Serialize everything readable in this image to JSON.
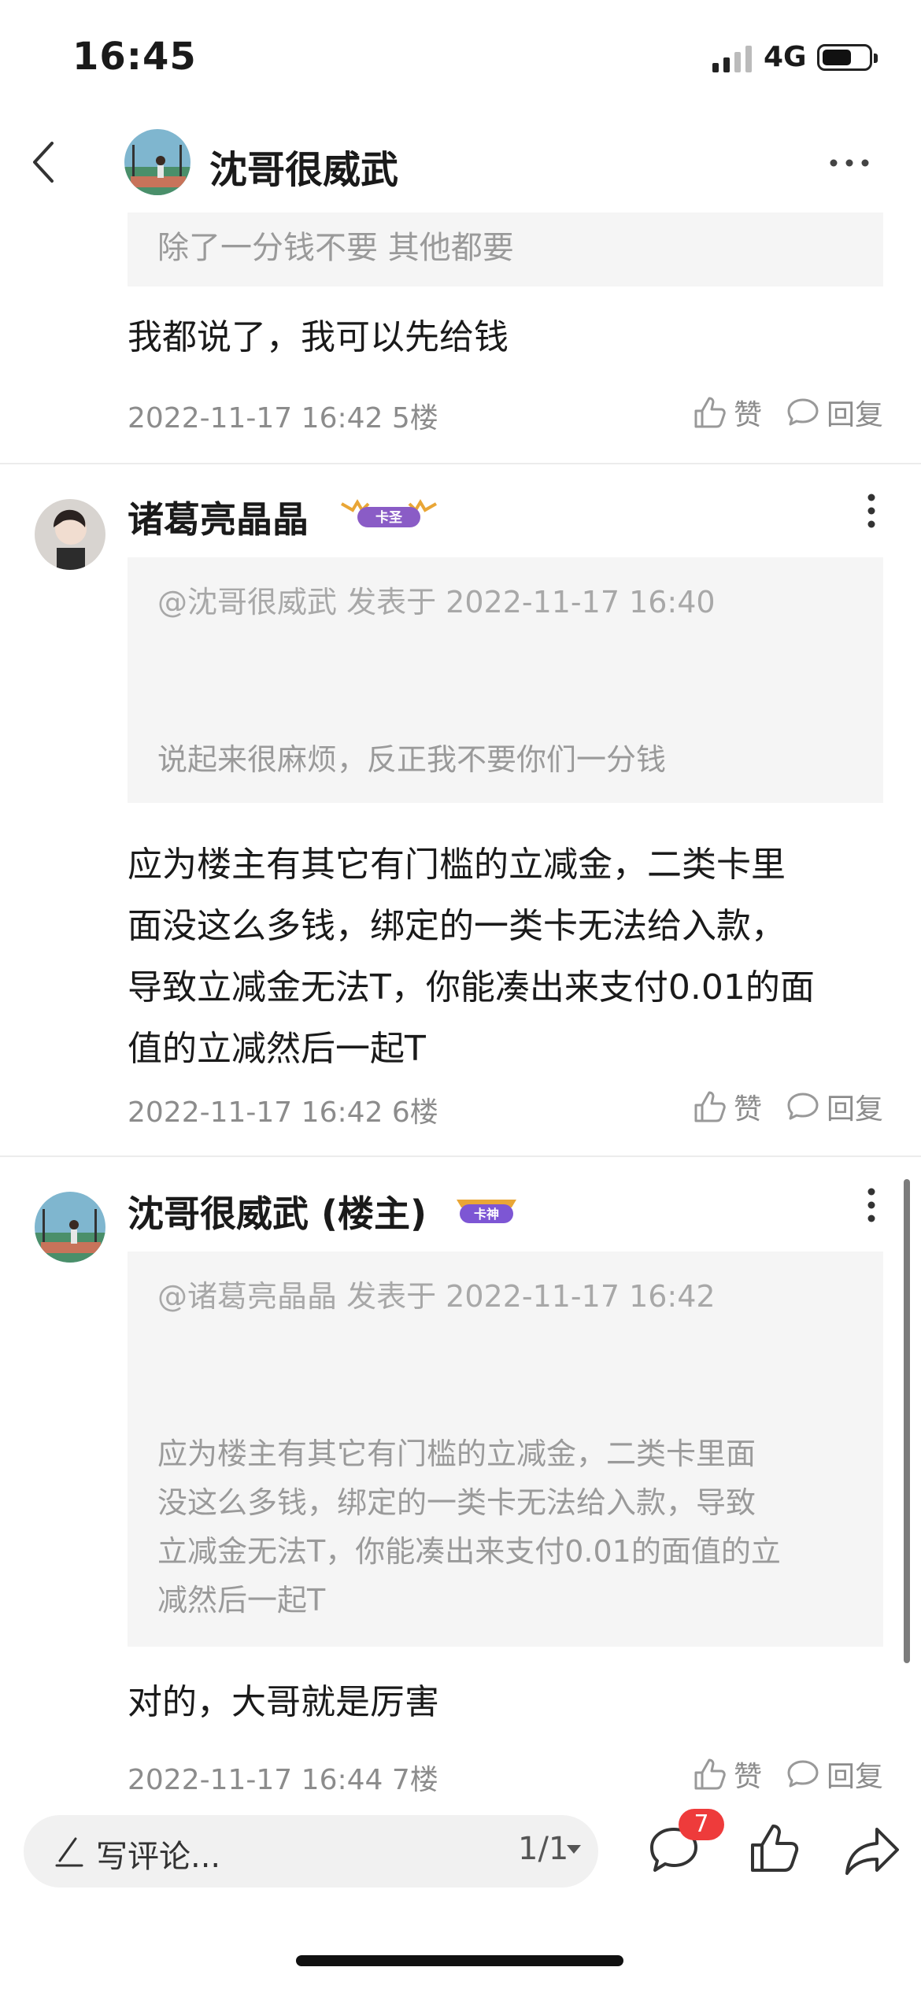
{
  "status_bar": {
    "time": "16:45",
    "network": "4G"
  },
  "nav": {
    "title": "沈哥很威武",
    "back_icon": "chevron-left-icon",
    "more_icon": "more-horizontal-icon"
  },
  "partial_quote": "除了一分钱不要 其他都要",
  "posts": [
    {
      "body": "我都说了，我可以先给钱",
      "meta": "2022-11-17 16:42  5楼",
      "like_label": "赞",
      "reply_label": "回复"
    },
    {
      "username": "诸葛亮晶晶",
      "badge": "卡圣",
      "quote_head": "@沈哥很威武 发表于 2022-11-17 16:40",
      "quote_body": "说起来很麻烦，反正我不要你们一分钱",
      "body_lines": [
        "应为楼主有其它有门槛的立减金，二类卡里",
        "面没这么多钱，绑定的一类卡无法给入款，",
        "导致立减金无法T，你能凑出来支付0.01的面",
        "值的立减然后一起T"
      ],
      "meta": "2022-11-17 16:42  6楼",
      "like_label": "赞",
      "reply_label": "回复"
    },
    {
      "username": "沈哥很威武 (楼主)",
      "badge": "卡神",
      "quote_head": "@诸葛亮晶晶 发表于 2022-11-17 16:42",
      "quote_lines": [
        "应为楼主有其它有门槛的立减金，二类卡里面",
        "没这么多钱，绑定的一类卡无法给入款，导致",
        "立减金无法T，你能凑出来支付0.01的面值的立",
        "减然后一起T"
      ],
      "body": "对的，大哥就是厉害",
      "meta": "2022-11-17 16:44  7楼",
      "like_label": "赞",
      "reply_label": "回复"
    }
  ],
  "bottom_bar": {
    "placeholder": "写评论...",
    "page": "1/1",
    "comment_count": "7"
  },
  "colors": {
    "accent_red": "#ee3b3b",
    "quote_bg": "#f5f5f5",
    "meta_gray": "#8c8c8c"
  }
}
